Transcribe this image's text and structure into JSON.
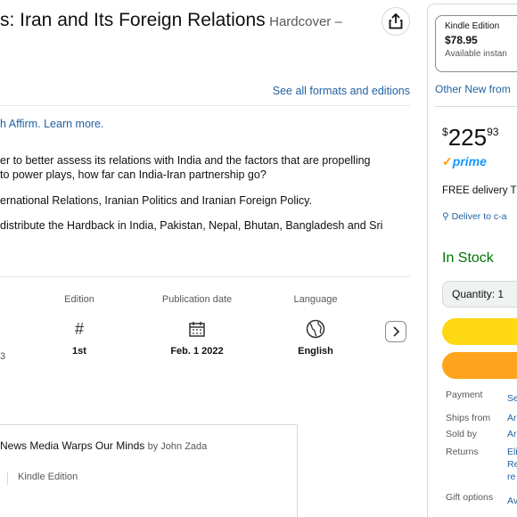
{
  "product": {
    "title": "s: Iran and Its Foreign Relations",
    "format_label": "Hardcover –"
  },
  "formats": {
    "see_all_label": "See all formats and editions"
  },
  "promo": {
    "affirm_text": "h Affirm. Learn more."
  },
  "description": {
    "line1": "er to better assess its relations with India and the factors that are propelling",
    "line2": "to power plays, how far can India-Iran partnership go?",
    "line3": "ernational Relations, Iranian Politics and Iranian Foreign Policy.",
    "line4": "distribute the Hardback in India, Pakistan, Nepal, Bhutan, Bangladesh and Sri"
  },
  "details": {
    "left_partial": "3",
    "items": [
      {
        "label": "Edition",
        "icon": "hash-icon",
        "value": "1st"
      },
      {
        "label": "Publication date",
        "icon": "calendar-icon",
        "value": "Feb. 1 2022"
      },
      {
        "label": "Language",
        "icon": "globe-icon",
        "value": "English"
      }
    ]
  },
  "sponsored": {
    "title": "News Media Warps Our Minds",
    "by": "by John Zada",
    "format": "Kindle Edition"
  },
  "buybox": {
    "kindle_label": "Kindle Edition",
    "kindle_price": "$78.95",
    "kindle_avail": "Available instan",
    "other_new": "Other New from",
    "price_currency": "$",
    "price_whole": "225",
    "price_fraction": "93",
    "prime_label": "prime",
    "free_delivery": "FREE delivery T",
    "deliver_to": "Deliver to c-a",
    "stock": "In Stock",
    "qty_label": "Quantity: 1",
    "info": [
      {
        "label": "Payment",
        "value": "Se"
      },
      {
        "label": "Ships from",
        "value": "Ar"
      },
      {
        "label": "Sold by",
        "value": "Ar"
      },
      {
        "label": "Returns",
        "value": "Eli"
      },
      {
        "label": "",
        "value": "Re"
      },
      {
        "label": "",
        "value": "re"
      },
      {
        "label": "Gift options",
        "value": "Av"
      }
    ]
  },
  "colors": {
    "link": "#2162a1",
    "in_stock": "#007600",
    "add_to_cart": "#ffd814",
    "buy_now": "#ffa41c",
    "prime": "#1399ff"
  }
}
